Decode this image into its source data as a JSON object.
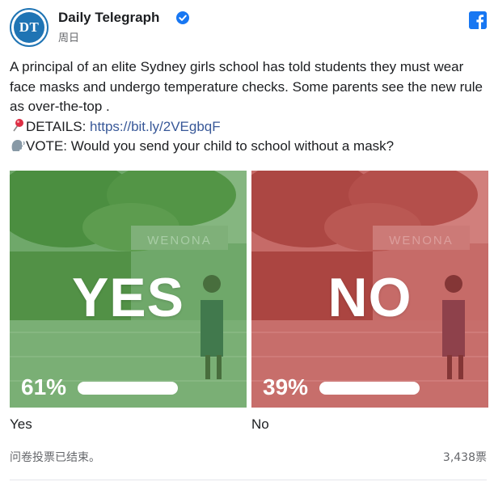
{
  "header": {
    "avatar_text": "DT",
    "page_name": "Daily Telegraph",
    "timestamp": "周日"
  },
  "post": {
    "body": "A principal of an elite Sydney girls school has told students they must wear face masks and undergo temperature checks. Some parents see the new rule as over-the-top .",
    "details_label": "DETAILS: ",
    "details_link": "https://bit.ly/2VEgbqF",
    "vote_label": "VOTE: Would you send your child to school without a mask?"
  },
  "poll": {
    "options": [
      {
        "word": "YES",
        "percent_text": "61%",
        "percent": 61,
        "label": "Yes"
      },
      {
        "word": "NO",
        "percent_text": "39%",
        "percent": 39,
        "label": "No"
      }
    ],
    "image_sign_text": "WENONA",
    "status": "问卷投票已结束。",
    "vote_count": "3,438票"
  },
  "colors": {
    "brand_blue": "#1f74b4",
    "facebook_blue": "#1877f2",
    "link": "#385898",
    "yes_tint": "#6fa86a",
    "no_tint": "#c46e6b"
  },
  "icons": {
    "verified": "verified-badge-icon",
    "facebook": "facebook-logo-icon",
    "pin": "round-pushpin-icon",
    "speaker": "speaking-head-icon"
  }
}
